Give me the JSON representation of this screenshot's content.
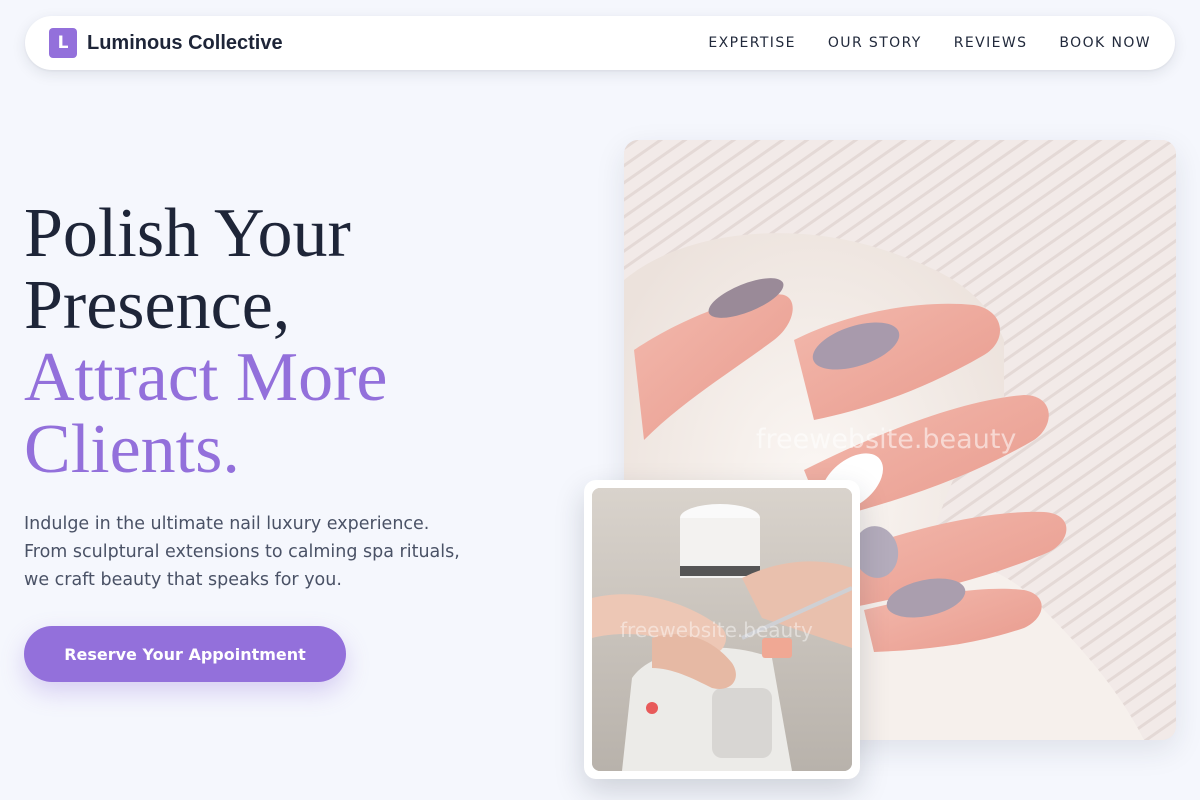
{
  "nav": {
    "logo_letter": "L",
    "brand": "Luminous Collective",
    "links": [
      "EXPERTISE",
      "OUR STORY",
      "REVIEWS",
      "BOOK NOW"
    ]
  },
  "hero": {
    "title_line1": "Polish Your",
    "title_line2": "Presence,",
    "title_accent1": "Attract More",
    "title_accent2": "Clients.",
    "description": "Indulge in the ultimate nail luxury experience. From sculptural extensions to calming spa rituals, we craft beauty that speaks for you.",
    "cta_label": "Reserve Your Appointment"
  },
  "images": {
    "main_alt": "Hands with lavender and white manicured nails resting on a white knit blanket",
    "inset_alt": "Nail technician filing a client's nails beside a UV lamp",
    "watermark_main": "freewebsite.beauty",
    "watermark_inset": "freewebsite.beauty"
  },
  "colors": {
    "accent": "#9370db",
    "text_dark": "#1e2538",
    "background": "#f5f7fd"
  }
}
